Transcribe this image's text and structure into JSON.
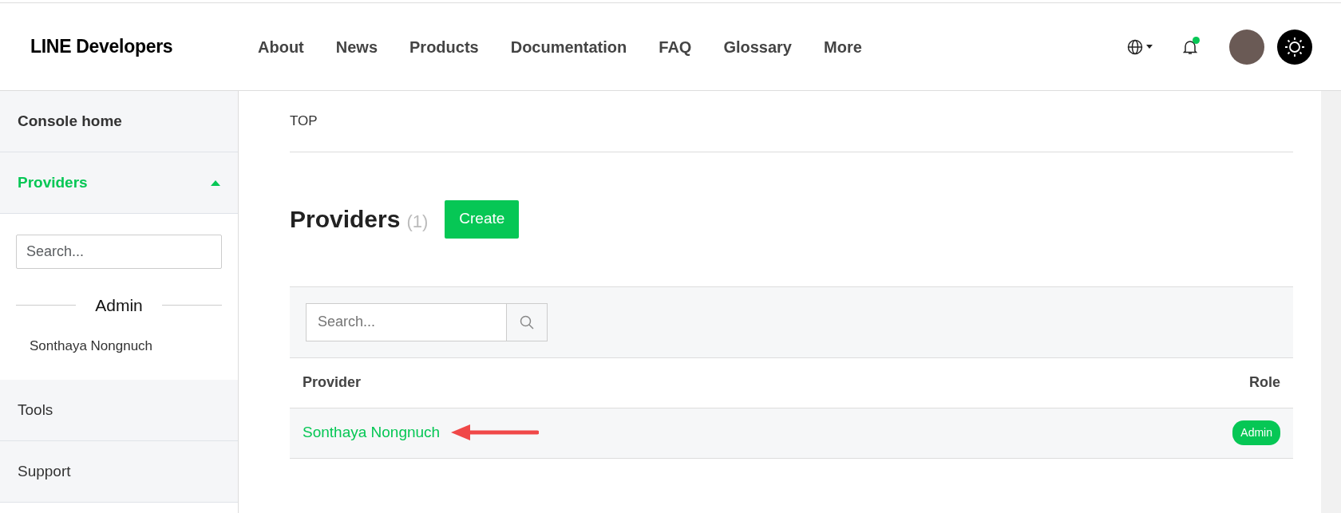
{
  "header": {
    "logo": "LINE Developers",
    "nav": [
      "About",
      "News",
      "Products",
      "Documentation",
      "FAQ",
      "Glossary",
      "More"
    ],
    "notification_unread": true
  },
  "sidebar": {
    "items": [
      {
        "label": "Console home",
        "kind": "section",
        "selected": false,
        "expanded": false
      },
      {
        "label": "Providers",
        "kind": "section",
        "selected": true,
        "expanded": true,
        "panel": {
          "search": {
            "placeholder": "Search..."
          },
          "group": "Admin",
          "entries": [
            "Sonthaya Nongnuch"
          ]
        }
      },
      {
        "label": "Tools",
        "kind": "link",
        "selected": false,
        "expanded": false
      },
      {
        "label": "Support",
        "kind": "link",
        "selected": false,
        "expanded": false
      }
    ]
  },
  "breadcrumb": "TOP",
  "title": "Providers",
  "count": "(1)",
  "create_button": "Create",
  "table": {
    "search": {
      "placeholder": "Search..."
    },
    "columns": [
      "Provider",
      "Role"
    ],
    "rows": [
      {
        "provider": "Sonthaya Nongnuch",
        "role": "Admin",
        "annotated": true
      }
    ]
  }
}
